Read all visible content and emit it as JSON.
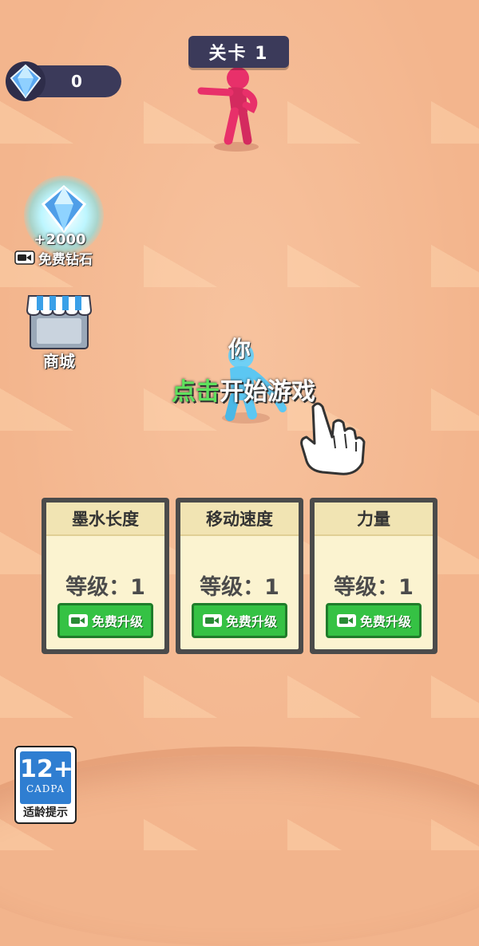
{
  "level_badge": {
    "label": "关卡  1"
  },
  "gems": {
    "count": "0",
    "icon": "diamond-icon"
  },
  "free_gems": {
    "amount": "+2000",
    "label": "免费钻石",
    "icon": "video-icon"
  },
  "shop": {
    "label": "商城",
    "icon": "store-icon"
  },
  "player": {
    "name": "你"
  },
  "start_prompt": {
    "highlight": "点击",
    "rest": "开始游戏"
  },
  "upgrades": [
    {
      "title": "墨水长度",
      "level": "等级：1",
      "button": "免费升级"
    },
    {
      "title": "移动速度",
      "level": "等级：1",
      "button": "免费升级"
    },
    {
      "title": "力量",
      "level": "等级：1",
      "button": "免费升级"
    }
  ],
  "age_rating": {
    "rating": "12+",
    "org": "CADPA",
    "tip": "适龄提示"
  },
  "colors": {
    "accent_green": "#35c244",
    "panel_dark": "#3b3a5a",
    "floor": "#f3b58d",
    "enemy": "#e8306a",
    "player": "#5cc7f2"
  }
}
